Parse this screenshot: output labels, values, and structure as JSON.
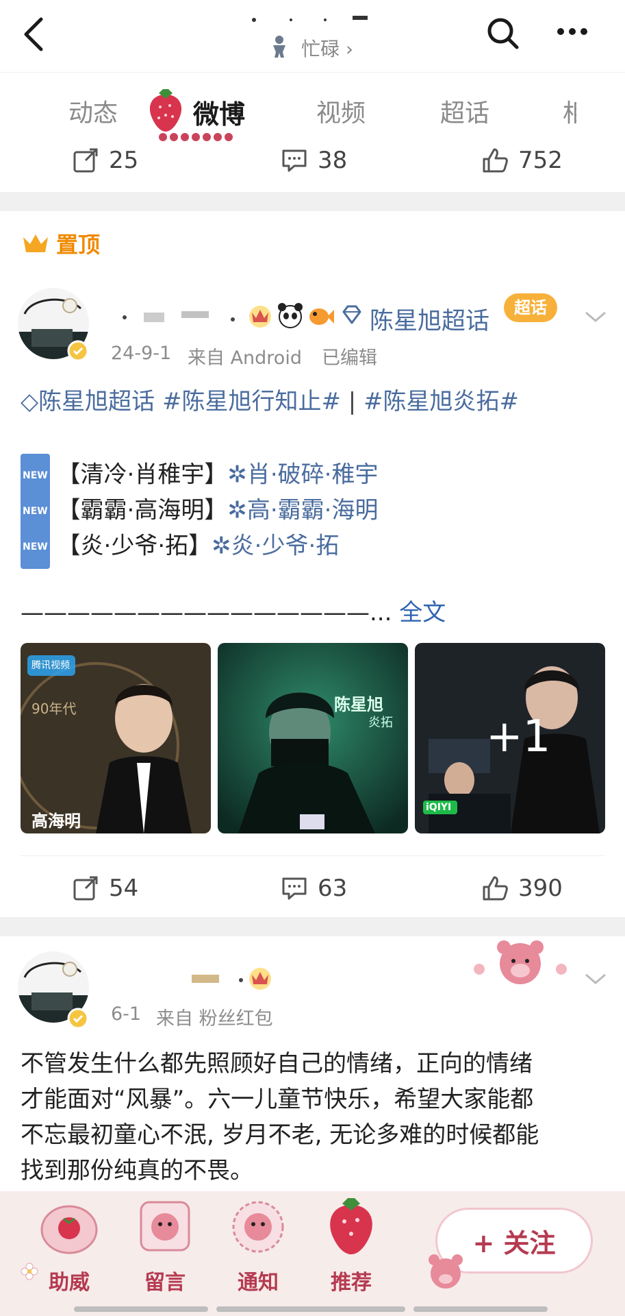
{
  "header": {
    "status_text": "忙碌 ›",
    "back_icon": "back-arrow-icon",
    "search_icon": "search-icon",
    "more_icon": "more-icon"
  },
  "tabs": [
    {
      "label": "动态"
    },
    {
      "label": "微博"
    },
    {
      "label": "视频"
    },
    {
      "label": "超话"
    },
    {
      "label": "相"
    }
  ],
  "prev_post_stats": {
    "reposts": "25",
    "comments": "38",
    "likes": "752"
  },
  "pinned_label": "置顶",
  "post1": {
    "topic_label": "陈星旭超话",
    "super_badge": "超话",
    "date": "24-9-1",
    "source": "来自 Android",
    "edited": "已编辑",
    "line1_topic": "陈星旭超话",
    "line1_tag1": "#陈星旭行知止#",
    "line1_sep": "|",
    "line1_tag2": "#陈星旭炎拓#",
    "new_badge": "NEW",
    "lines": [
      {
        "bracket": "【清冷·肖稚宇】",
        "rest": "肖·破碎·稚宇"
      },
      {
        "bracket": "【霸霸·高海明】",
        "rest": "高·霸霸·海明"
      },
      {
        "bracket": "【炎·少爷·拓】",
        "rest": "炎·少爷·拓"
      }
    ],
    "dash_line": "———————————————...",
    "full_text": "全文",
    "images": [
      {
        "caption": "高海明",
        "side": "90年代",
        "badge": "腾讯视频"
      },
      {
        "caption": "陈星旭",
        "sub": "炎拓"
      },
      {
        "more": "+1",
        "badge": "iQIYI"
      }
    ],
    "stats": {
      "reposts": "54",
      "comments": "63",
      "likes": "390"
    }
  },
  "post2": {
    "date": "6-1",
    "source": "来自 粉丝红包",
    "text_lines": [
      "不管发生什么都先照顾好自己的情绪，正向的情绪",
      "才能面对“风暴”。六一儿童节快乐，希望大家能都",
      "不忘最初童心不泯, 岁月不老, 无论多难的时候都能",
      "找到那份纯真的不畏。"
    ]
  },
  "bottom_bar": {
    "items": [
      {
        "label": "助威"
      },
      {
        "label": "留言"
      },
      {
        "label": "通知"
      },
      {
        "label": "推荐"
      }
    ],
    "follow_label": "+ 关注"
  },
  "colors": {
    "accent_blue": "#2f64b0",
    "link_blue": "#4a6c9e",
    "pin_orange": "#f08a00",
    "bottom_bar_bg": "#f6ecea",
    "bottom_label": "#b53a50"
  }
}
